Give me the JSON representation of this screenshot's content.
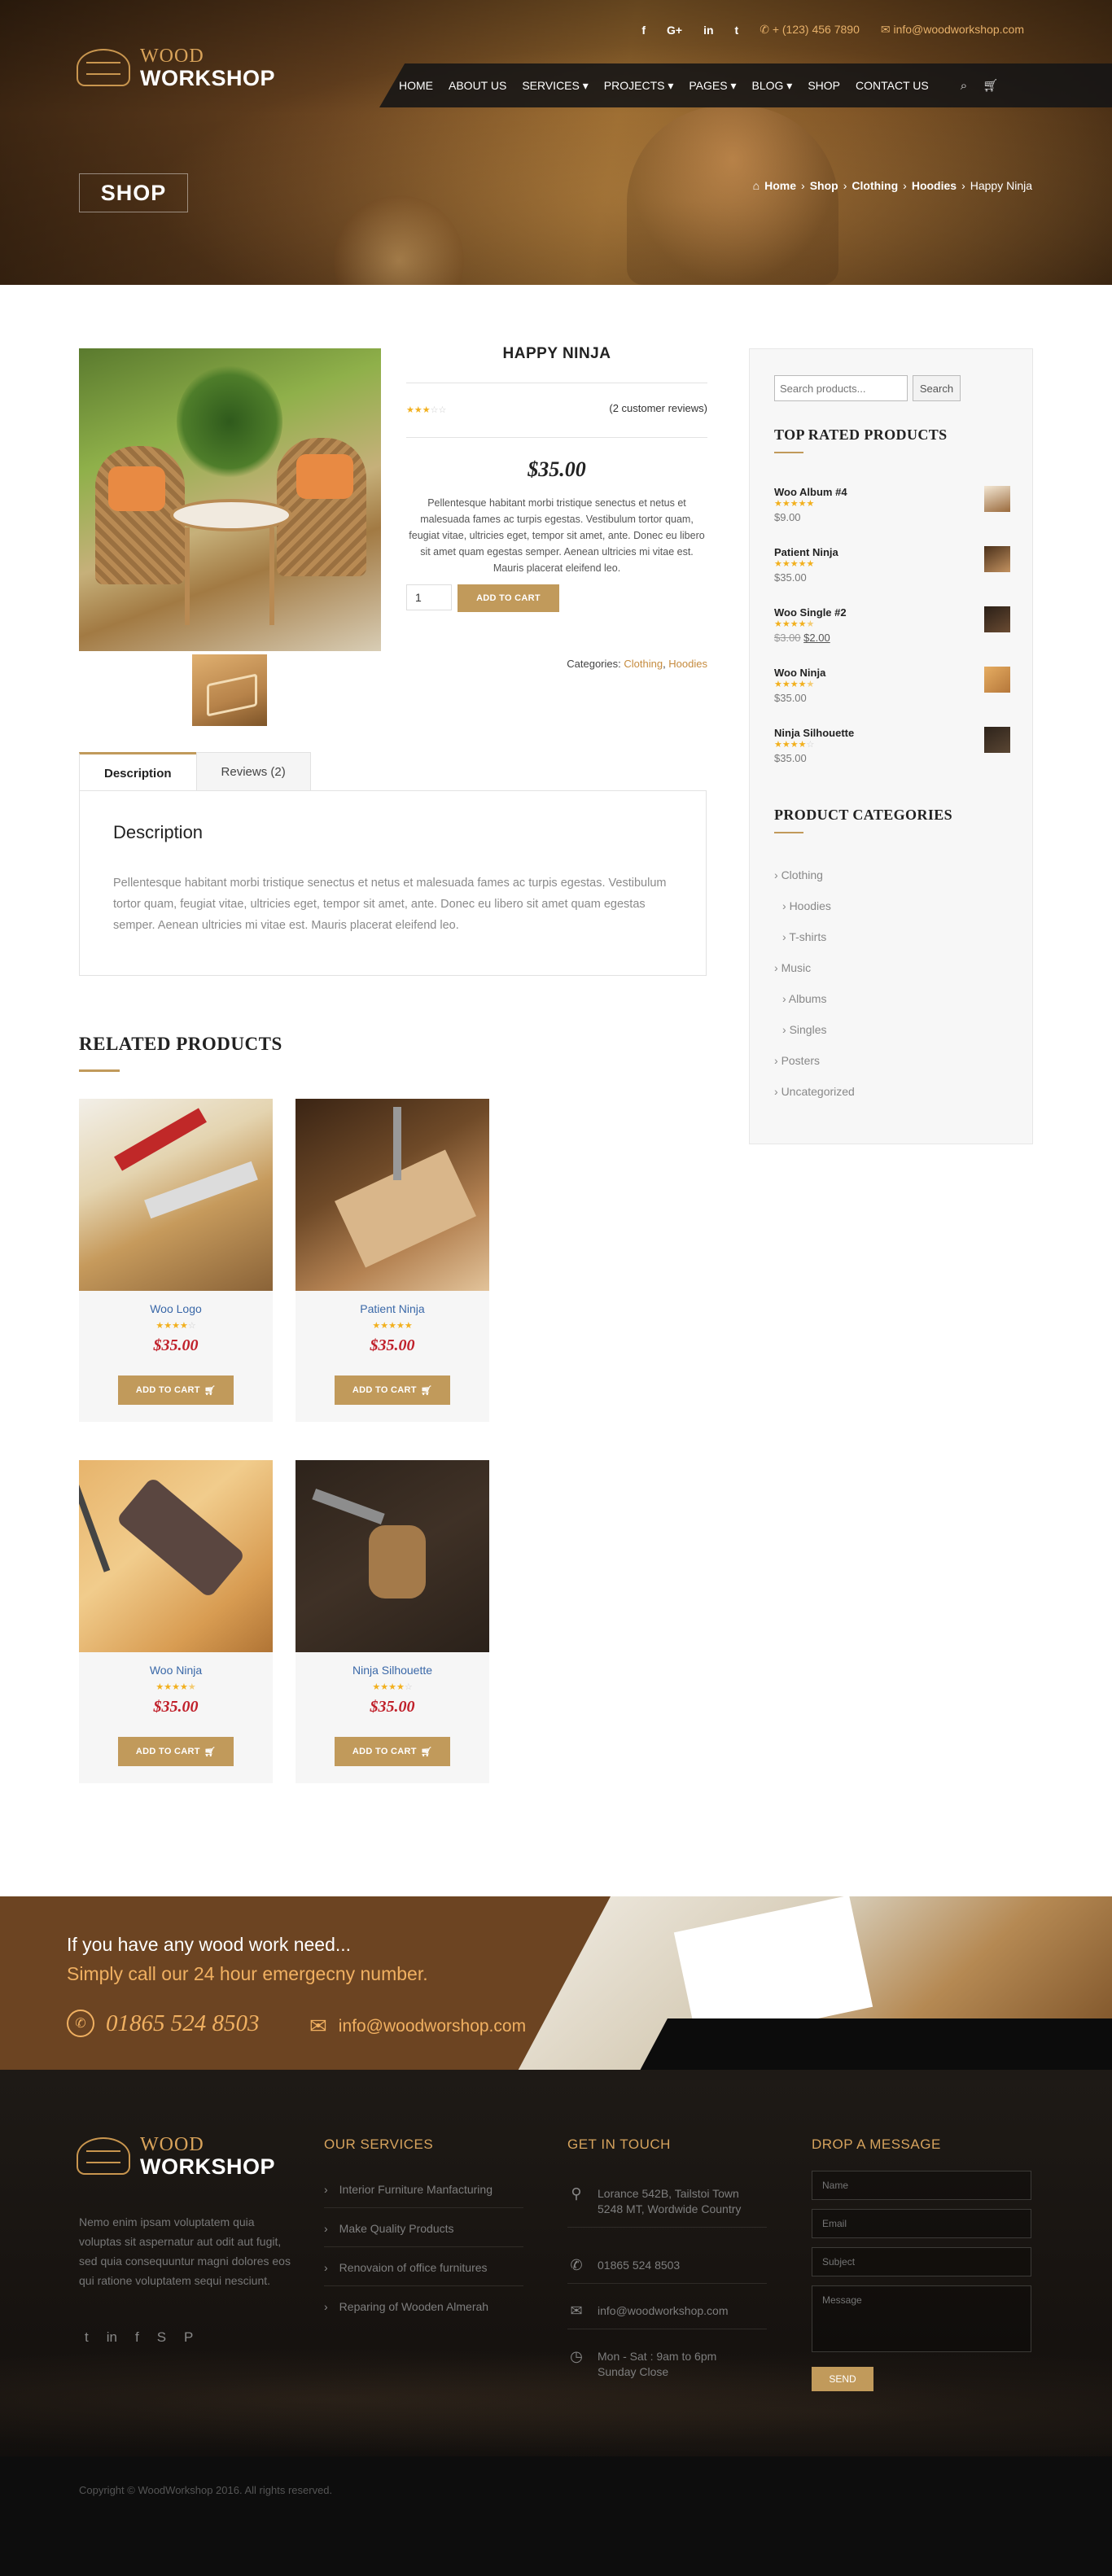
{
  "header": {
    "social": [
      {
        "icon": "facebook-icon",
        "glyph": "f"
      },
      {
        "icon": "google-plus-icon",
        "glyph": "G+"
      },
      {
        "icon": "linkedin-icon",
        "glyph": "in"
      },
      {
        "icon": "twitter-icon",
        "glyph": "t"
      }
    ],
    "phone": "+ (123) 456 7890",
    "email": "info@woodworkshop.com",
    "logo_top": "WOOD",
    "logo_bottom": "WORKSHOP",
    "nav": [
      "HOME",
      "ABOUT US",
      "SERVICES ▾",
      "PROJECTS ▾",
      "PAGES ▾",
      "BLOG ▾",
      "SHOP",
      "CONTACT US"
    ],
    "page_title": "SHOP",
    "breadcrumb": [
      "Home",
      "Shop",
      "Clothing",
      "Hoodies",
      "Happy Ninja"
    ]
  },
  "product": {
    "title": "HAPPY NINJA",
    "rating": 3,
    "reviews": "(2 customer reviews)",
    "price": "$35.00",
    "description": "Pellentesque habitant morbi tristique senectus et netus et malesuada fames ac turpis egestas. Vestibulum tortor quam, feugiat vitae, ultricies eget, tempor sit amet, ante. Donec eu libero sit amet quam egestas semper. Aenean ultricies mi vitae est. Mauris placerat eleifend leo.",
    "qty": "1",
    "add_to_cart": "ADD TO CART",
    "categories_label": "Categories:",
    "categories": [
      "Clothing",
      "Hoodies"
    ]
  },
  "tabs": {
    "items": [
      "Description",
      "Reviews (2)"
    ],
    "heading": "Description",
    "text": "Pellentesque habitant morbi tristique senectus et netus et malesuada fames ac turpis egestas. Vestibulum tortor quam, feugiat vitae, ultricies eget, tempor sit amet, ante. Donec eu libero sit amet quam egestas semper. Aenean ultricies mi vitae est. Mauris placerat eleifend leo."
  },
  "related": {
    "heading": "RELATED PRODUCTS",
    "button": "ADD TO CART",
    "items": [
      {
        "name": "Woo Logo",
        "rating": 4,
        "price": "$35.00"
      },
      {
        "name": "Patient Ninja",
        "rating": 5,
        "price": "$35.00"
      },
      {
        "name": "Woo Ninja",
        "rating": 4.5,
        "price": "$35.00"
      },
      {
        "name": "Ninja Silhouette",
        "rating": 4,
        "price": "$35.00"
      }
    ]
  },
  "sidebar": {
    "search_placeholder": "Search products...",
    "search_button": "Search",
    "top_rated_heading": "TOP RATED PRODUCTS",
    "top_rated": [
      {
        "name": "Woo Album #4",
        "rating": 5,
        "price": "$9.00",
        "old": ""
      },
      {
        "name": "Patient Ninja",
        "rating": 5,
        "price": "$35.00",
        "old": ""
      },
      {
        "name": "Woo Single #2",
        "rating": 4.5,
        "price": "$2.00",
        "old": "$3.00"
      },
      {
        "name": "Woo Ninja",
        "rating": 4.5,
        "price": "$35.00",
        "old": ""
      },
      {
        "name": "Ninja Silhouette",
        "rating": 4,
        "price": "$35.00",
        "old": ""
      }
    ],
    "categories_heading": "PRODUCT CATEGORIES",
    "categories": [
      {
        "label": "Clothing",
        "sub": false
      },
      {
        "label": "Hoodies",
        "sub": true
      },
      {
        "label": "T-shirts",
        "sub": true
      },
      {
        "label": "Music",
        "sub": false
      },
      {
        "label": "Albums",
        "sub": true
      },
      {
        "label": "Singles",
        "sub": true
      },
      {
        "label": "Posters",
        "sub": false
      },
      {
        "label": "Uncategorized",
        "sub": false
      }
    ]
  },
  "cta": {
    "line1": "If you have any wood work need...",
    "line2": "Simply call our 24 hour emergecny number.",
    "phone": "01865 524 8503",
    "email": "info@woodworshop.com"
  },
  "footer": {
    "about": "Nemo enim ipsam voluptatem quia voluptas sit aspernatur aut odit aut fugit, sed quia consequuntur magni dolores eos qui ratione voluptatem sequi nesciunt.",
    "social": [
      "twitter-icon",
      "linkedin-icon",
      "facebook-icon",
      "skype-icon",
      "pinterest-icon"
    ],
    "services_heading": "OUR SERVICES",
    "services": [
      "Interior Furniture Manfacturing",
      "Make Quality Products",
      "Renovaion of office furnitures",
      "Reparing of Wooden Almerah"
    ],
    "touch_heading": "GET IN TOUCH",
    "touch": [
      {
        "icon": "location-icon",
        "text": "Lorance 542B, Tailstoi Town 5248 MT, Wordwide Country"
      },
      {
        "icon": "phone-icon",
        "text": "01865 524 8503"
      },
      {
        "icon": "mail-icon",
        "text": "info@woodworkshop.com"
      },
      {
        "icon": "clock-icon",
        "text": "Mon - Sat : 9am to 6pm Sunday Close"
      }
    ],
    "message_heading": "DROP A MESSAGE",
    "fields": [
      "Name",
      "Email",
      "Subject",
      "Message"
    ],
    "send": "SEND",
    "copyright": "Copyright © WoodWorkshop 2016. All rights reserved."
  },
  "colors": {
    "accent": "#c19a5b",
    "price": "#c0202a",
    "link": "#3a68a8"
  }
}
